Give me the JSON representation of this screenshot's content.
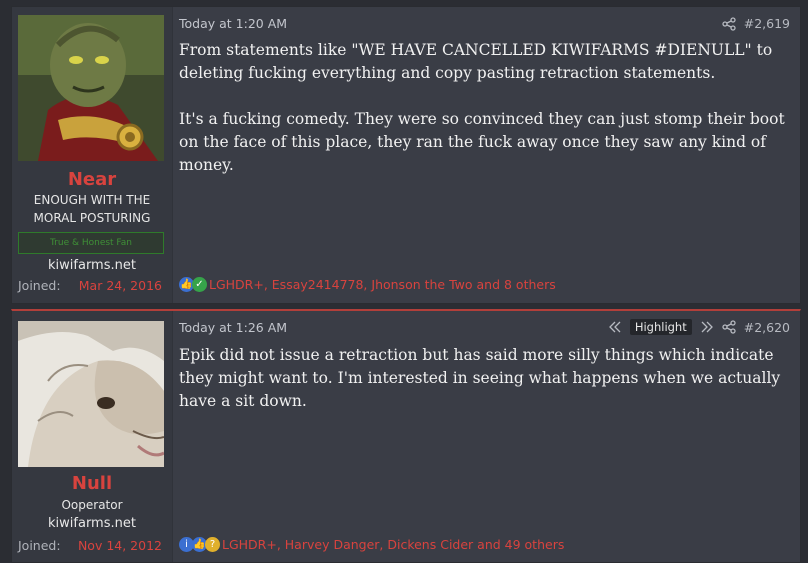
{
  "posts": [
    {
      "username": "Near",
      "user_title": "ENOUGH WITH THE MORAL POSTURING",
      "banner": "True & Honest Fan",
      "site": "kiwifarms.net",
      "joined_label": "Joined:",
      "joined_date": "Mar 24, 2016",
      "timestamp": "Today at 1:20 AM",
      "post_number": "#2,619",
      "body": [
        "From statements like \"WE HAVE CANCELLED KIWIFARMS #DIENULL\" to deleting fucking everything and copy pasting retraction statements.",
        "It's a fucking comedy. They were so convinced they can just stomp their boot on the face of this place, they ran the fuck away once they saw any kind of money."
      ],
      "reactions": "LGHDR+, Essay2414778, Jhonson the Two and 8 others"
    },
    {
      "username": "Null",
      "user_title": "Ooperator",
      "site": "kiwifarms.net",
      "joined_label": "Joined:",
      "joined_date": "Nov 14, 2012",
      "timestamp": "Today at 1:26 AM",
      "highlight_label": "Highlight",
      "post_number": "#2,620",
      "body": [
        "Epik did not issue a retraction but has said more silly things which indicate they might want to. I'm interested in seeing what happens when we actually have a sit down."
      ],
      "reactions": "LGHDR+, Harvey Danger, Dickens Cider and 49 others"
    }
  ],
  "colors": {
    "username": "#d8433e",
    "background": "#2b2d33",
    "post_bg": "#3a3d46"
  }
}
